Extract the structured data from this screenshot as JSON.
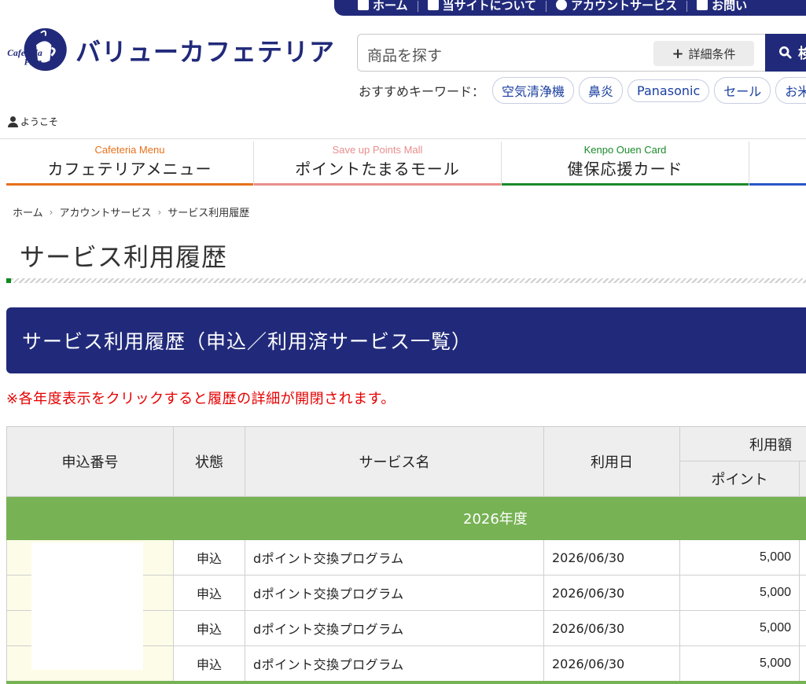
{
  "topnav": [
    {
      "label": "ホーム",
      "icon": "home-icon"
    },
    {
      "label": "当サイトについて",
      "icon": "book-icon"
    },
    {
      "label": "アカウントサービス",
      "icon": "check-circle-icon"
    },
    {
      "label": "お問い",
      "icon": "mail-icon"
    }
  ],
  "logo": {
    "mark_line1": "Cafeteria",
    "mark_line2": "Plan",
    "brand": "バリューカフェテリア"
  },
  "search": {
    "placeholder": "商品を探す",
    "detail_label": "詳細条件",
    "button_label": "検"
  },
  "keywords": {
    "label": "おすすめキーワード：",
    "items": [
      "空気清浄機",
      "鼻炎",
      "Panasonic",
      "セール",
      "お米"
    ]
  },
  "welcome": "ようこそ",
  "menu": [
    {
      "en": "Cafeteria Menu",
      "jp": "カフェテリアメニュー",
      "color": "#e8701a"
    },
    {
      "en": "Save up Points Mall",
      "jp": "ポイントたまるモール",
      "color": "#e98d8d"
    },
    {
      "en": "Kenpo Ouen Card",
      "jp": "健保応援カード",
      "color": "#1a8a2a"
    },
    {
      "en": "",
      "jp": "",
      "color": "#2a55c8"
    }
  ],
  "breadcrumb": [
    "ホーム",
    "アカウントサービス",
    "サービス利用履歴"
  ],
  "page_title": "サービス利用履歴",
  "banner": "サービス利用履歴（申込／利用済サービス一覧）",
  "note": "※各年度表示をクリックすると履歴の詳細が開閉されます。",
  "table": {
    "headers": {
      "number": "申込番号",
      "status": "状態",
      "service": "サービス名",
      "date": "利用日",
      "amount": "利用額",
      "points": "ポイント"
    },
    "year": "2026年度",
    "rows": [
      {
        "status": "申込",
        "service": "dポイント交換プログラム",
        "date": "2026/06/30",
        "points": "5,000"
      },
      {
        "status": "申込",
        "service": "dポイント交換プログラム",
        "date": "2026/06/30",
        "points": "5,000"
      },
      {
        "status": "申込",
        "service": "dポイント交換プログラム",
        "date": "2026/06/30",
        "points": "5,000"
      },
      {
        "status": "申込",
        "service": "dポイント交換プログラム",
        "date": "2026/06/30",
        "points": "5,000"
      }
    ]
  }
}
